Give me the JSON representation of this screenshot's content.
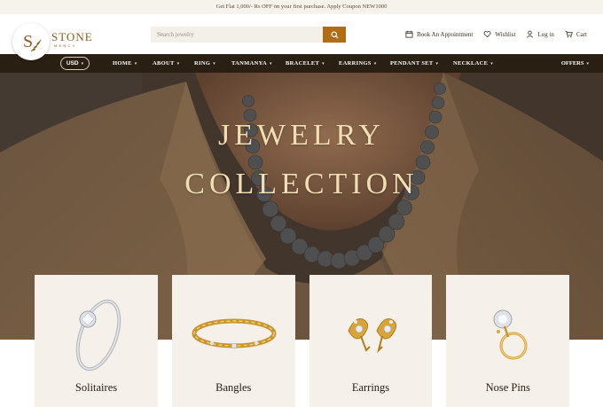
{
  "promo": {
    "text": "Get Flat 1,000/- Rs OFF on your first purchase. Apply Coupon NEW1000"
  },
  "brand": {
    "name": "STONE",
    "subtitle": "MENCY"
  },
  "search": {
    "placeholder": "Search jewelry"
  },
  "header_links": {
    "appointment": "Book An Appointment",
    "wishlist": "Wishlist",
    "login": "Log in",
    "cart": "Cart"
  },
  "nav": {
    "currency": "USD",
    "items": [
      {
        "label": "HOME"
      },
      {
        "label": "ABOUT"
      },
      {
        "label": "RING"
      },
      {
        "label": "TANMANYA"
      },
      {
        "label": "BRACELET"
      },
      {
        "label": "EARRINGS"
      },
      {
        "label": "PENDANT SET"
      },
      {
        "label": "NECKLACE"
      }
    ],
    "offers": "OFFERS"
  },
  "hero": {
    "line1": "JEWELRY",
    "line2": "COLLECTION"
  },
  "categories": [
    {
      "label": "Solitaires",
      "icon": "ring-icon"
    },
    {
      "label": "Bangles",
      "icon": "bracelet-icon"
    },
    {
      "label": "Earrings",
      "icon": "earrings-icon"
    },
    {
      "label": "Nose Pins",
      "icon": "nose-pin-icon"
    }
  ],
  "colors": {
    "nav_bg": "#2a1f13",
    "accent": "#b06d16",
    "hero_text": "#f1dfb4",
    "card_bg": "#f5f0ea",
    "promo_bg": "#f6f2ec"
  }
}
